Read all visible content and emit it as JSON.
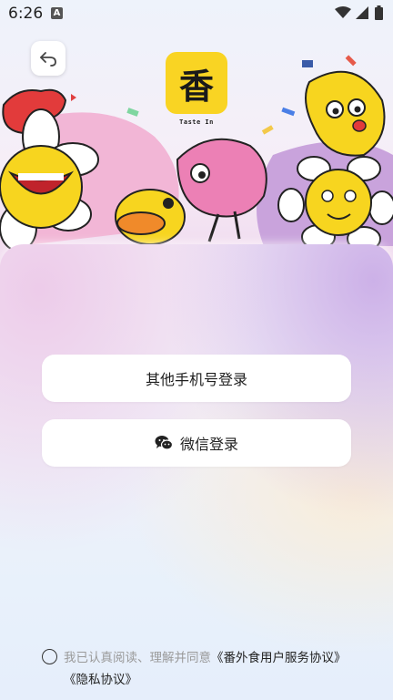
{
  "status_bar": {
    "time": "6:26",
    "notification_icon": "a-letter-icon",
    "icons": [
      "wifi-icon",
      "signal-icon",
      "battery-icon"
    ]
  },
  "header": {
    "back_icon": "back-arrow-icon",
    "logo_glyph": "香",
    "brand_text": "Taste In"
  },
  "login": {
    "phone_button_label": "其他手机号登录",
    "wechat_button_label": "微信登录",
    "wechat_icon": "wechat-icon"
  },
  "agreement": {
    "prefix": "我已认真阅读、理解并同意",
    "service_link": "《番外食用户服务协议》",
    "privacy_link": "《隐私协议》"
  },
  "colors": {
    "logo_bg": "#f9d423",
    "button_bg": "#ffffff",
    "muted_text": "#9a9a9a"
  }
}
